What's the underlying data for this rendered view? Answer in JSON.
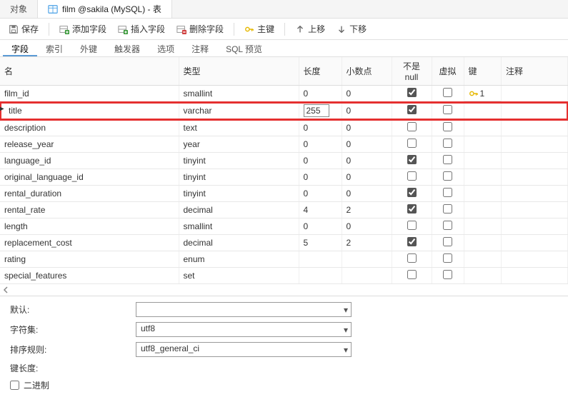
{
  "top_tabs": {
    "object": "对象",
    "active": "film @sakila (MySQL) - 表"
  },
  "toolbar": {
    "save": "保存",
    "add_field": "添加字段",
    "insert_field": "插入字段",
    "delete_field": "删除字段",
    "primary_key": "主键",
    "move_up": "上移",
    "move_down": "下移"
  },
  "inner_tabs": [
    "字段",
    "索引",
    "外键",
    "触发器",
    "选项",
    "注释",
    "SQL 预览"
  ],
  "inner_active": 0,
  "columns": {
    "name": "名",
    "type": "类型",
    "length": "长度",
    "scale": "小数点",
    "not_null": "不是 null",
    "virtual": "虚拟",
    "key": "键",
    "comment": "注释"
  },
  "rows": [
    {
      "name": "film_id",
      "type": "smallint",
      "len": "0",
      "scale": "0",
      "nn": true,
      "virt": false,
      "key": "1"
    },
    {
      "name": "title",
      "type": "varchar",
      "len": "255",
      "scale": "0",
      "nn": true,
      "virt": false,
      "key": "",
      "editing": true,
      "highlight": true
    },
    {
      "name": "description",
      "type": "text",
      "len": "0",
      "scale": "0",
      "nn": false,
      "virt": false,
      "key": ""
    },
    {
      "name": "release_year",
      "type": "year",
      "len": "0",
      "scale": "0",
      "nn": false,
      "virt": false,
      "key": ""
    },
    {
      "name": "language_id",
      "type": "tinyint",
      "len": "0",
      "scale": "0",
      "nn": true,
      "virt": false,
      "key": ""
    },
    {
      "name": "original_language_id",
      "type": "tinyint",
      "len": "0",
      "scale": "0",
      "nn": false,
      "virt": false,
      "key": ""
    },
    {
      "name": "rental_duration",
      "type": "tinyint",
      "len": "0",
      "scale": "0",
      "nn": true,
      "virt": false,
      "key": ""
    },
    {
      "name": "rental_rate",
      "type": "decimal",
      "len": "4",
      "scale": "2",
      "nn": true,
      "virt": false,
      "key": ""
    },
    {
      "name": "length",
      "type": "smallint",
      "len": "0",
      "scale": "0",
      "nn": false,
      "virt": false,
      "key": ""
    },
    {
      "name": "replacement_cost",
      "type": "decimal",
      "len": "5",
      "scale": "2",
      "nn": true,
      "virt": false,
      "key": ""
    },
    {
      "name": "rating",
      "type": "enum",
      "len": "",
      "scale": "",
      "nn": false,
      "virt": false,
      "key": ""
    },
    {
      "name": "special_features",
      "type": "set",
      "len": "",
      "scale": "",
      "nn": false,
      "virt": false,
      "key": ""
    }
  ],
  "props": {
    "default_label": "默认:",
    "default_value": "",
    "charset_label": "字符集:",
    "charset_value": "utf8",
    "collate_label": "排序规则:",
    "collate_value": "utf8_general_ci",
    "keylen_label": "键长度:",
    "keylen_value": "",
    "binary_label": "二进制",
    "binary_checked": false
  }
}
